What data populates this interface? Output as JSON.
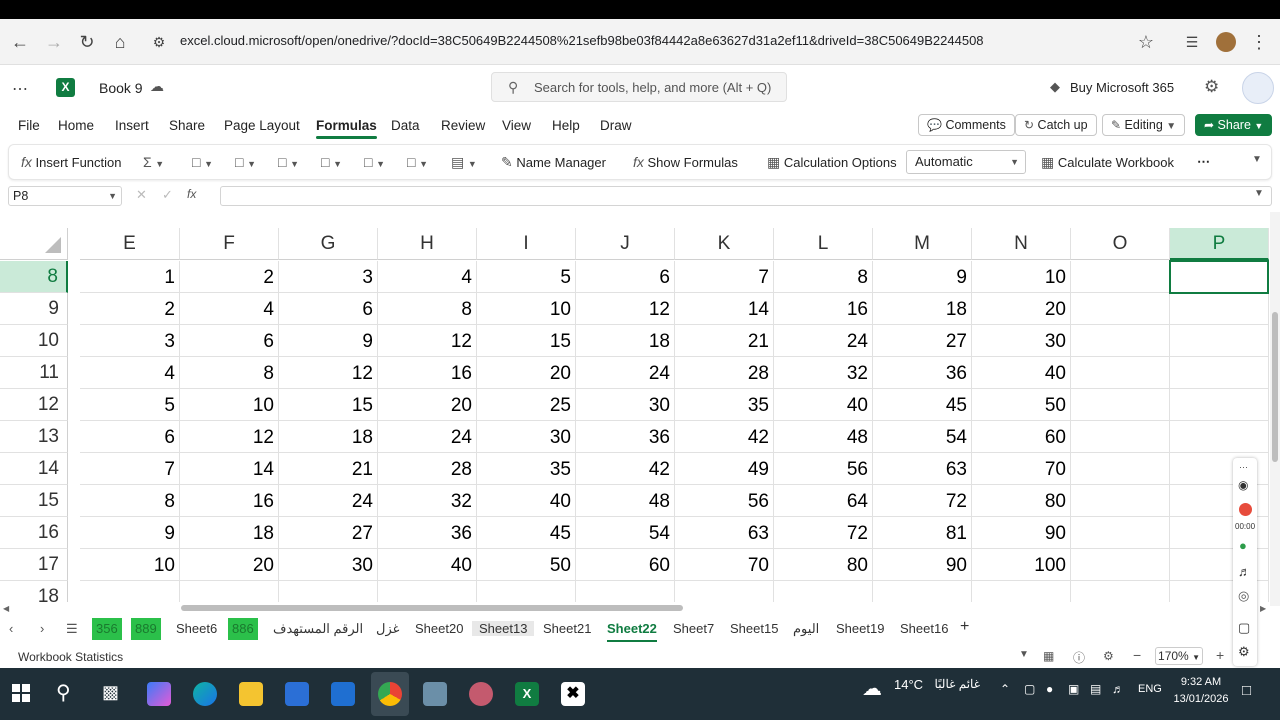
{
  "browser": {
    "url": "excel.cloud.microsoft/open/onedrive/?docId=38C50649B2244508%21sefb98be03f84442a8e63627d31a2ef11&driveId=38C50649B2244508"
  },
  "app": {
    "book_title": "Book 9",
    "search_placeholder": "Search for tools, help, and more (Alt + Q)",
    "buy_label": "Buy Microsoft 365"
  },
  "menu": {
    "items": [
      "File",
      "Home",
      "Insert",
      "Share",
      "Page Layout",
      "Formulas",
      "Data",
      "Review",
      "View",
      "Help",
      "Draw"
    ],
    "active": "Formulas",
    "comments": "Comments",
    "catchup": "Catch up",
    "editing": "Editing",
    "share": "Share"
  },
  "ribbon": {
    "insert_function": "Insert Function",
    "name_manager": "Name Manager",
    "show_formulas": "Show Formulas",
    "calc_options": "Calculation Options",
    "calc_mode": "Automatic",
    "calc_workbook": "Calculate Workbook"
  },
  "formula_bar": {
    "name_box": "P8",
    "fx": "fx",
    "value": ""
  },
  "sheet": {
    "columns": [
      "E",
      "F",
      "G",
      "H",
      "I",
      "J",
      "K",
      "L",
      "M",
      "N",
      "O",
      "P"
    ],
    "selected_column": "P",
    "selected_row": "8",
    "rows": [
      {
        "num": "8",
        "cells": [
          "1",
          "2",
          "3",
          "4",
          "5",
          "6",
          "7",
          "8",
          "9",
          "10",
          "",
          ""
        ]
      },
      {
        "num": "9",
        "cells": [
          "2",
          "4",
          "6",
          "8",
          "10",
          "12",
          "14",
          "16",
          "18",
          "20",
          "",
          ""
        ]
      },
      {
        "num": "10",
        "cells": [
          "3",
          "6",
          "9",
          "12",
          "15",
          "18",
          "21",
          "24",
          "27",
          "30",
          "",
          ""
        ]
      },
      {
        "num": "11",
        "cells": [
          "4",
          "8",
          "12",
          "16",
          "20",
          "24",
          "28",
          "32",
          "36",
          "40",
          "",
          ""
        ]
      },
      {
        "num": "12",
        "cells": [
          "5",
          "10",
          "15",
          "20",
          "25",
          "30",
          "35",
          "40",
          "45",
          "50",
          "",
          ""
        ]
      },
      {
        "num": "13",
        "cells": [
          "6",
          "12",
          "18",
          "24",
          "30",
          "36",
          "42",
          "48",
          "54",
          "60",
          "",
          ""
        ]
      },
      {
        "num": "14",
        "cells": [
          "7",
          "14",
          "21",
          "28",
          "35",
          "42",
          "49",
          "56",
          "63",
          "70",
          "",
          ""
        ]
      },
      {
        "num": "15",
        "cells": [
          "8",
          "16",
          "24",
          "32",
          "40",
          "48",
          "56",
          "64",
          "72",
          "80",
          "",
          ""
        ]
      },
      {
        "num": "16",
        "cells": [
          "9",
          "18",
          "27",
          "36",
          "45",
          "54",
          "63",
          "72",
          "81",
          "90",
          "",
          ""
        ]
      },
      {
        "num": "17",
        "cells": [
          "10",
          "20",
          "30",
          "40",
          "50",
          "60",
          "70",
          "80",
          "90",
          "100",
          "",
          ""
        ]
      },
      {
        "num": "18",
        "cells": [
          "",
          "",
          "",
          "",
          "",
          "",
          "",
          "",
          "",
          "",
          "",
          ""
        ]
      }
    ]
  },
  "tabs": {
    "green_tabs": [
      "356",
      "889"
    ],
    "items": [
      "Sheet6",
      "886",
      "الرقم المستهدف",
      "غزل",
      "Sheet20",
      "Sheet13",
      "Sheet21",
      "Sheet22",
      "Sheet7",
      "Sheet15",
      "اليوم",
      "Sheet19",
      "Sheet16"
    ],
    "active": "Sheet22"
  },
  "status": {
    "left": "Workbook Statistics",
    "zoom": "170%"
  },
  "taskbar": {
    "weather_temp": "14°C",
    "weather_text": "غائم غالبًا",
    "lang": "ENG",
    "time": "9:32 AM",
    "date": "13/01/2026"
  },
  "colors": {
    "accent": "#107c41",
    "selected_header_bg": "#caead8",
    "taskbar": "#1f2f38"
  }
}
